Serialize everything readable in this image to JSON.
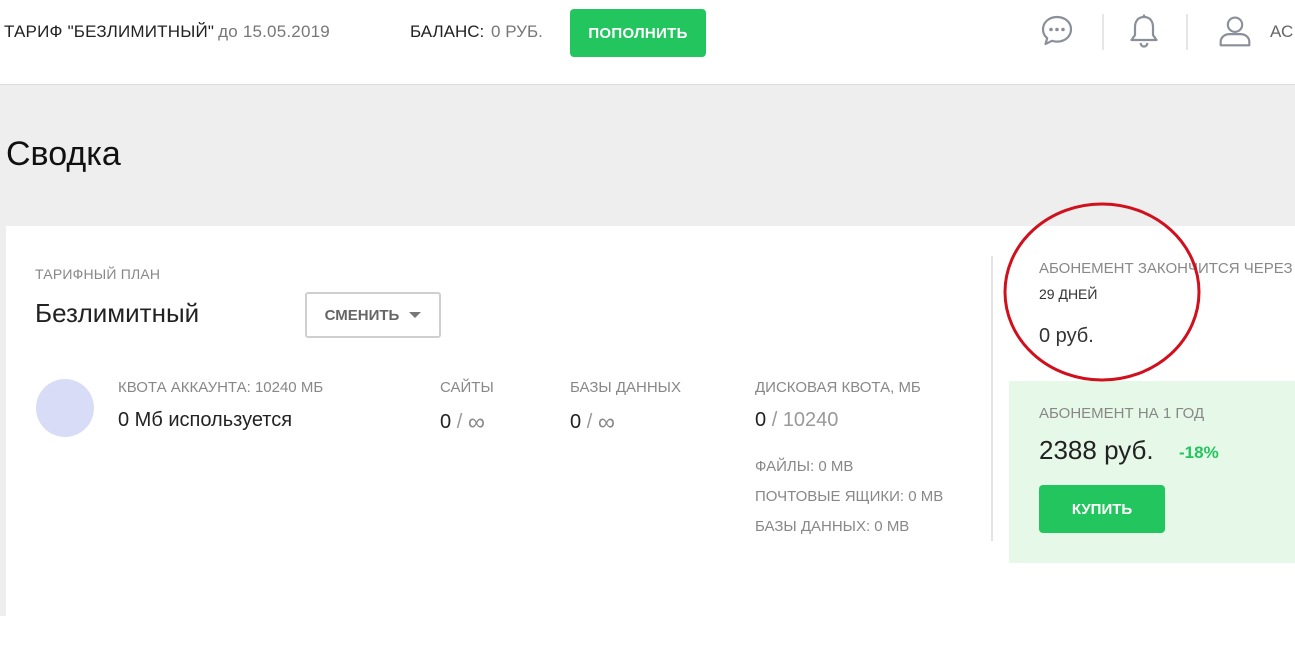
{
  "header": {
    "tariff_name": "ТАРИФ \"БЕЗЛИМИТНЫЙ\"",
    "tariff_until": "до 15.05.2019",
    "balance_label": "БАЛАНС:",
    "balance_value": "0 РУБ.",
    "topup_label": "ПОПОЛНИТЬ",
    "user_name": "АС",
    "icons": [
      "chat-icon",
      "bell-icon",
      "user-icon"
    ]
  },
  "main": {
    "title": "Сводка",
    "plan": {
      "label": "ТАРИФНЫЙ ПЛАН",
      "name": "Безлимитный",
      "change_label": "СМЕНИТЬ"
    },
    "stats": {
      "quota_label": "КВОТА АККАУНТА: 10240 МБ",
      "quota_value": "0 Мб используется",
      "sites_label": "САЙТЫ",
      "sites_used": "0",
      "databases_label": "БАЗЫ ДАННЫХ",
      "databases_used": "0",
      "disk_label": "ДИСКОВАЯ КВОТА, МБ",
      "disk_used": "0",
      "disk_total": "10240",
      "files_line": "ФАЙЛЫ: 0 MB",
      "mail_line": "ПОЧТОВЫЕ ЯЩИКИ: 0 MB",
      "db_line": "БАЗЫ ДАННЫХ: 0 MB",
      "infinity": "∞",
      "separator": "/"
    },
    "subscription": {
      "ends_label": "АБОНЕМЕНТ ЗАКОНЧИТСЯ ЧЕРЕЗ",
      "days": "29 ДНЕЙ",
      "price": "0 руб."
    },
    "annual": {
      "label": "АБОНЕМЕНТ НА 1 ГОД",
      "price": "2388 руб.",
      "discount": "-18%",
      "buy_label": "КУПИТЬ"
    }
  },
  "colors": {
    "accent_green": "#22c55e",
    "annual_bg": "#e6f8e8",
    "annotation_red": "#d0101c",
    "page_bg": "#eeeeef"
  }
}
